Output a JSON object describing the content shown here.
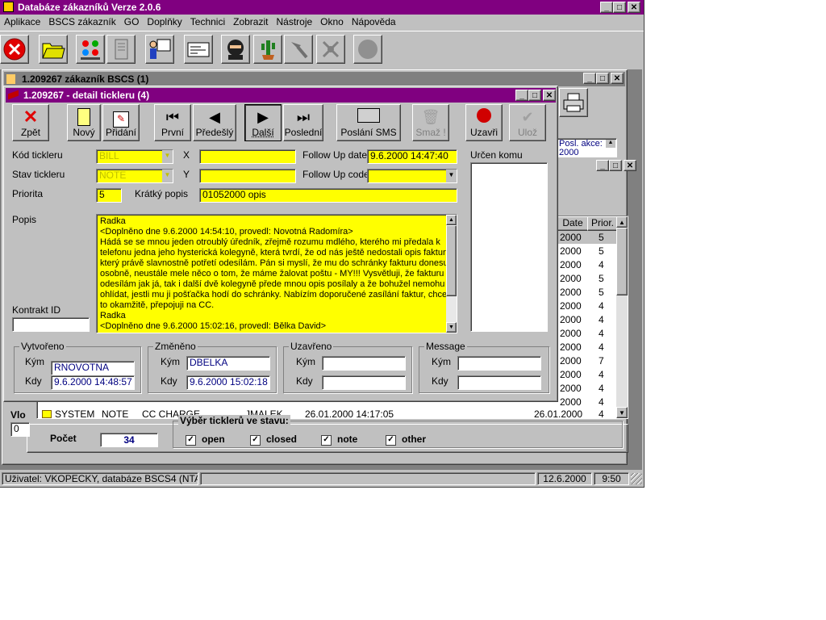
{
  "main_window": {
    "title": "Databáze zákazníků   Verze 2.0.6",
    "menu": [
      "Aplikace",
      "BSCS zákazník",
      "GO",
      "Doplňky",
      "Technici",
      "Zobrazit",
      "Nástroje",
      "Okno",
      "Nápověda"
    ],
    "accent": "#800080"
  },
  "toolbar": {
    "icons": [
      "close-red-icon",
      "folder-icon",
      "traffic-lights-icon",
      "document-icon",
      "presenter-icon",
      "card-icon",
      "ninja-icon",
      "cactus-icon",
      "hammer-icon",
      "satellite-icon",
      "circle-icon"
    ]
  },
  "customer_window": {
    "title": "1.209267 zákazník BSCS (1)",
    "posl_akce_label": "Posl. akce:",
    "posl_akce_value": "2000",
    "vlo_label": "Vlo",
    "vlo_value": "0"
  },
  "ticklers_list": {
    "headers": {
      "date": "Date",
      "prior": "Prior."
    },
    "right_rows": [
      {
        "date": "2000",
        "prior": "5"
      },
      {
        "date": "2000",
        "prior": "5"
      },
      {
        "date": "2000",
        "prior": "4"
      },
      {
        "date": "2000",
        "prior": "5"
      },
      {
        "date": "2000",
        "prior": "5"
      },
      {
        "date": "2000",
        "prior": "4"
      },
      {
        "date": "2000",
        "prior": "4"
      },
      {
        "date": "2000",
        "prior": "4"
      },
      {
        "date": "2000",
        "prior": "4"
      },
      {
        "date": "2000",
        "prior": "7"
      },
      {
        "date": "2000",
        "prior": "4"
      },
      {
        "date": "2000",
        "prior": "4"
      },
      {
        "date": "2000",
        "prior": "4"
      }
    ],
    "last_row": {
      "user": "SYSTEM",
      "type": "NOTE",
      "code": "CC CHARGE",
      "who": "JMALEK",
      "created": "26.01.2000 14:17:05",
      "date": "26.01.2000",
      "prior": "4"
    },
    "pocet_label": "Počet",
    "pocet_value": "34",
    "filter_title": "Výběr ticklerů ve stavu:",
    "filters": [
      {
        "label": "open",
        "checked": "✓"
      },
      {
        "label": "closed",
        "checked": "✓"
      },
      {
        "label": "note",
        "checked": "✓"
      },
      {
        "label": "other",
        "checked": "✓"
      }
    ]
  },
  "detail_window": {
    "title": "1.209267 - detail tickleru (4)",
    "buttons": {
      "zpet": "Zpět",
      "novy": "Nový",
      "pridani": "Přidání",
      "prvni": "První",
      "predesly": "Předešlý",
      "dalsi": "Další",
      "posledni": "Poslední",
      "sms": "Poslání SMS",
      "smaz": "Smaž !",
      "uzavri": "Uzavři",
      "uloz": "Ulož"
    },
    "labels": {
      "kod": "Kód tickleru",
      "stav": "Stav tickleru",
      "priorita": "Priorita",
      "x": "X",
      "y": "Y",
      "followup_date": "Follow Up date",
      "followup_code": "Follow Up code",
      "kratky": "Krátký popis",
      "urcen": "Určen komu",
      "popis": "Popis",
      "kontrakt": "Kontrakt ID"
    },
    "values": {
      "kod": "BILL",
      "stav": "NOTE",
      "priorita": "5",
      "x": "",
      "y": "",
      "followup_date": "9.6.2000 14:47:40",
      "followup_code": "",
      "kratky": "01052000 opis",
      "kontrakt": ""
    },
    "popis_lines": [
      "Radka",
      "<Doplněno dne 9.6.2000 14:54:10, provedl: Novotná Radomíra>",
      "Hádá se se mnou jeden otroublý úředník, zřejmě rozumu mdlého, kterého mi předala k",
      "telefonu jedna jeho hysterická kolegyně, která tvrdí, že od nás ještě nedostali opis faktury,",
      "který právě slavnostně potřetí odesílám. Pán si myslí, že mu do schránky fakturu donesu",
      "osobně, neustále mele něco o tom, že máme žalovat poštu - MY!!!  Vysvětluji, že fakturu",
      "odesílám jak já, tak i další dvě kolegyně přede mnou opis posílaly a že bohužel nemohu",
      "ohlídat, jestli mu ji pošťačka hodí do schránky. Nabízím doporučené zasílání faktur, chce",
      "to okamžitě, přepojuji na CC.",
      "Radka",
      "<Doplněno dne 9.6.2000 15:02:16, provedl: Bělka David>"
    ],
    "groups": {
      "vytvoreno": {
        "title": "Vytvořeno",
        "kym_label": "Kým",
        "kdy_label": "Kdy",
        "kym": "RNOVOTNA",
        "kdy": "9.6.2000 14:48:57"
      },
      "zmeneno": {
        "title": "Změněno",
        "kym_label": "Kým",
        "kdy_label": "Kdy",
        "kym": "DBELKA",
        "kdy": "9.6.2000 15:02:18"
      },
      "uzavreno": {
        "title": "Uzavřeno",
        "kym_label": "Kým",
        "kdy_label": "Kdy",
        "kym": "",
        "kdy": ""
      },
      "message": {
        "title": "Message",
        "kym_label": "Kým",
        "kdy_label": "Kdy",
        "kym": "",
        "kdy": ""
      }
    }
  },
  "statusbar": {
    "user": "Uživatel: VKOPECKY, databáze BSCS4 (NTAPP1)",
    "date": "12.6.2000",
    "time": "9:50"
  }
}
